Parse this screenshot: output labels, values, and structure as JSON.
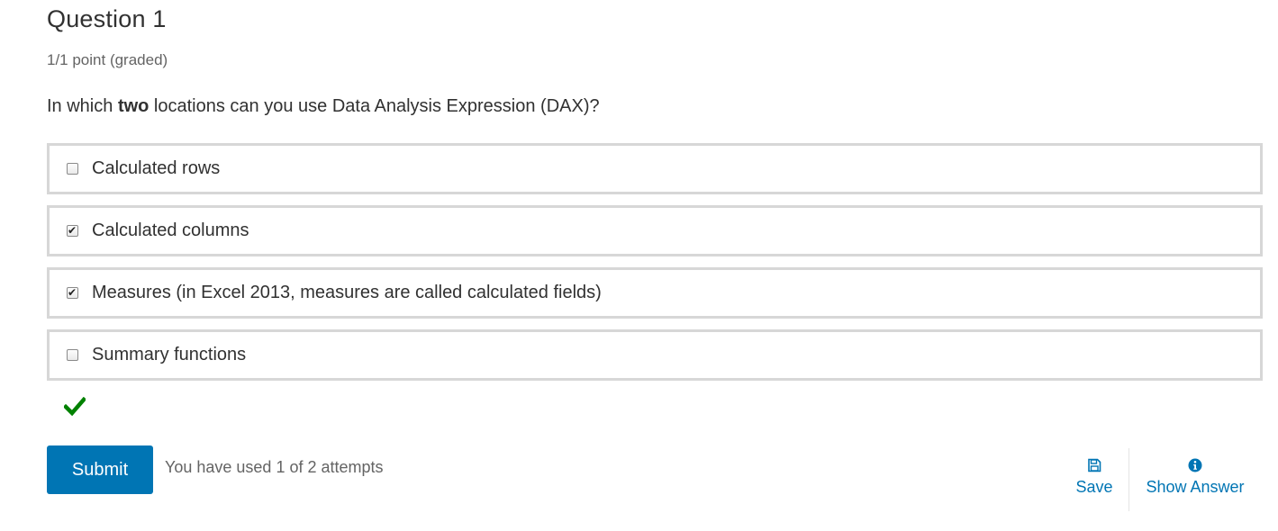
{
  "question": {
    "title": "Question 1",
    "points": "1/1 point (graded)",
    "prompt_before": "In which ",
    "prompt_bold": "two",
    "prompt_after": " locations can you use Data Analysis Expression (DAX)?"
  },
  "choices": [
    {
      "label": "Calculated rows",
      "checked": false
    },
    {
      "label": "Calculated columns",
      "checked": true
    },
    {
      "label": "Measures (in Excel 2013, measures are called calculated fields)",
      "checked": true
    },
    {
      "label": "Summary functions",
      "checked": false
    }
  ],
  "status": {
    "icon": "correct-check-icon",
    "color": "#008100"
  },
  "actions": {
    "submit_label": "Submit",
    "attempts_text": "You have used 1 of 2 attempts",
    "save_label": "Save",
    "save_icon": "floppy-disk-icon",
    "show_answer_label": "Show Answer",
    "show_answer_icon": "info-circle-icon",
    "accent_color": "#0075b4"
  }
}
